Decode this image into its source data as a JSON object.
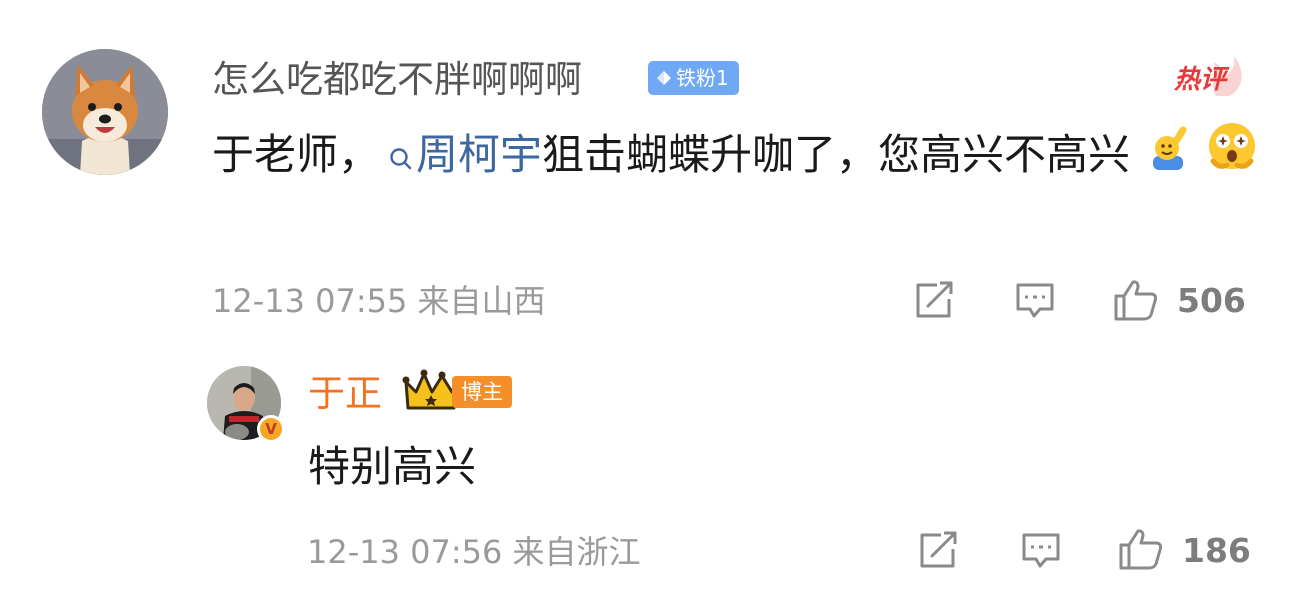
{
  "comment": {
    "username": "怎么吃都吃不胖啊啊啊",
    "fan_badge": "铁粉1",
    "hot_tag": "热评",
    "text_before": "于老师，",
    "link_text": "周柯宇",
    "text_after": "狙击蝴蝶升咖了，您高兴不高兴",
    "timestamp": "12-13 07:55",
    "location": "来自山西",
    "likes": "506",
    "icons": [
      "share-icon",
      "reply-icon",
      "like-icon"
    ],
    "emojis": [
      "raising-hand-emoji",
      "sparkly-eyes-emoji"
    ]
  },
  "reply": {
    "username": "于正",
    "role_badge": "博主",
    "verified": "V",
    "text": "特别高兴",
    "timestamp": "12-13 07:56",
    "location": "来自浙江",
    "likes": "186"
  },
  "colors": {
    "link": "#3d67a3",
    "host_name": "#f37321",
    "fan_badge": "#6fa8f5",
    "hot_tag": "#e8393a"
  }
}
